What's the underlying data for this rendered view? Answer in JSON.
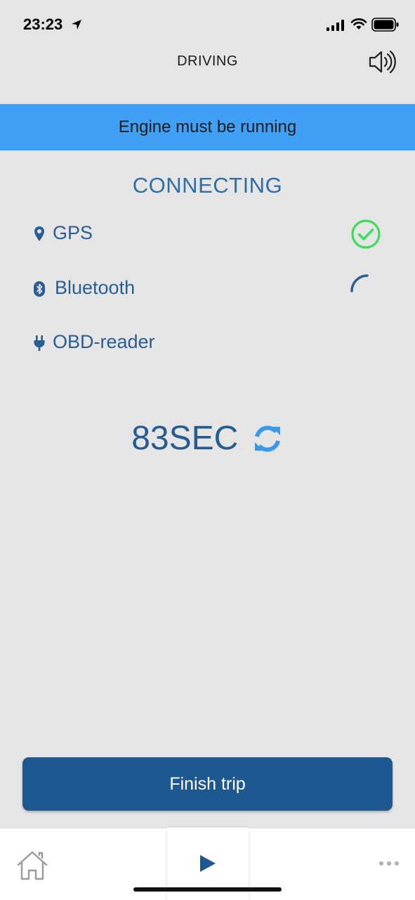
{
  "status_bar": {
    "time": "23:23"
  },
  "header": {
    "title": "DRIVING",
    "sound_icon": "speaker-icon"
  },
  "banner": {
    "text": "Engine must be running",
    "color": "#3fa0f5"
  },
  "connection": {
    "title": "CONNECTING",
    "items": [
      {
        "label": "GPS",
        "icon": "map-pin-icon",
        "status": "connected"
      },
      {
        "label": "Bluetooth",
        "icon": "bluetooth-icon",
        "status": "loading"
      },
      {
        "label": "OBD-reader",
        "icon": "plug-icon",
        "status": "pending"
      }
    ]
  },
  "timer": {
    "text": "83SEC",
    "icon": "refresh-icon"
  },
  "actions": {
    "finish_label": "Finish trip"
  },
  "tab_bar": {
    "items": [
      {
        "icon": "home-icon"
      },
      {
        "icon": "play-icon"
      },
      {
        "icon": "more-icon"
      }
    ]
  },
  "colors": {
    "primary": "#1e5890",
    "text_blue": "#2a5d92",
    "success": "#3ddc5a",
    "background": "#e5e5e5"
  }
}
